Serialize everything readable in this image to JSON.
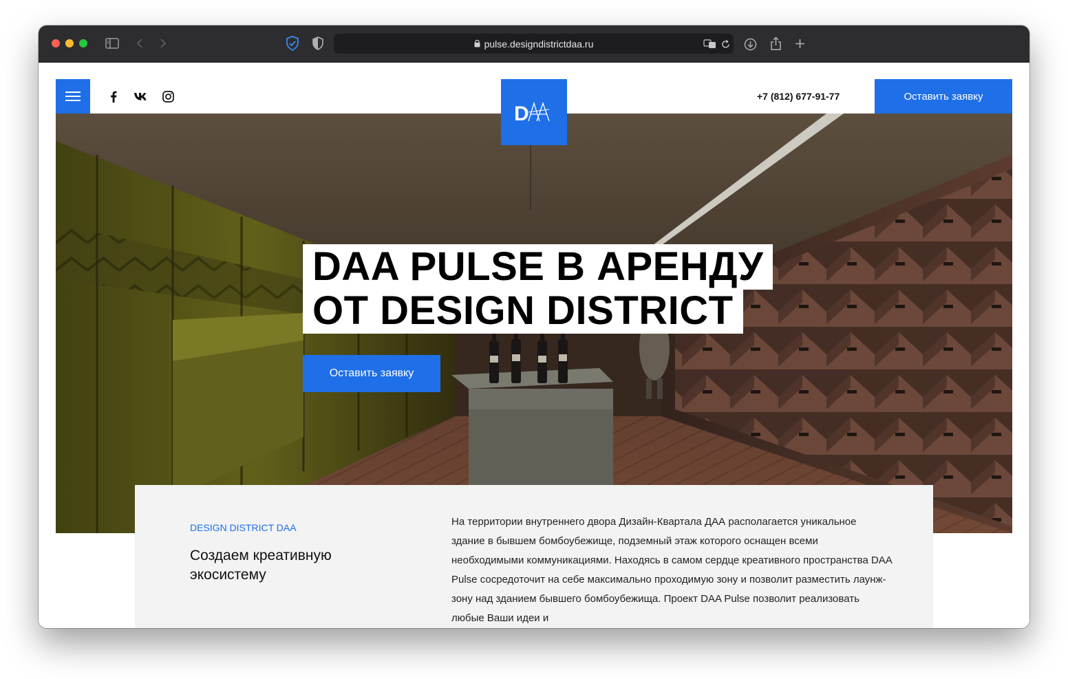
{
  "browser": {
    "url": "pulse.designdistrictdaa.ru",
    "traffic_light_colors": [
      "#ff5f57",
      "#febc2e",
      "#28c840"
    ]
  },
  "header": {
    "logo_text": "DAA",
    "social": [
      "facebook-icon",
      "vk-icon",
      "instagram-icon"
    ],
    "phone": "+7 (812) 677-91-77",
    "cta_label": "Оставить заявку"
  },
  "hero": {
    "title_line1": "DAA PULSE В АРЕНДУ",
    "title_line2": "ОТ DESIGN DISTRICT",
    "cta_label": "Оставить заявку"
  },
  "about": {
    "kicker": "DESIGN DISTRICT DAA",
    "title": "Создаем креативную экосистему",
    "text": "На территории внутреннего двора Дизайн-Квартала ДАА располагается уникальное здание в бывшем бомбоубежище, подземный этаж которого оснащен всеми необходимыми коммуникациями. Находясь в самом сердце креативного пространства DAA Pulse сосредоточит на себе максимально проходимую зону и позволит разместить лаунж-зону над зданием бывшего бомбоубежища. Проект DAA Pulse позволит реализовать любые Ваши идеи и"
  },
  "colors": {
    "accent": "#1f6fe8",
    "toolbar": "#2d2d2f",
    "about_bg": "#f3f3f3"
  }
}
